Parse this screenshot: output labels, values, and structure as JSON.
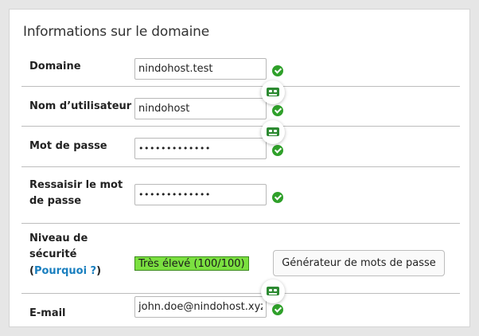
{
  "section": {
    "title": "Informations sur le domaine"
  },
  "rows": {
    "domain": {
      "label": "Domaine",
      "value": "nindohost.test"
    },
    "username": {
      "label": "Nom d’utilisateur",
      "value": "nindohost"
    },
    "password": {
      "label": "Mot de passe",
      "value": "•••••••••••••"
    },
    "confirm": {
      "label_line1": "Ressaisir le mot",
      "label_line2": "de passe",
      "value": "•••••••••••••"
    },
    "security": {
      "label_line1": "Niveau de",
      "label_line2": "sécurité",
      "paren_open": "(",
      "why_link": "Pourquoi ?",
      "paren_close": ")",
      "strength_text": "Très élevé (100/100)",
      "strength_percent": 100,
      "generator_button": "Générateur de mots de passe"
    },
    "email": {
      "label": "E-mail",
      "value": "john.doe@nindohost.xyz"
    }
  },
  "icons": {
    "check": "check-circle-icon",
    "keyboard": "keyboard-icon"
  },
  "colors": {
    "check": "#2fa02a",
    "strength_bg": "#7be040",
    "link": "#1a7fbf",
    "kb_icon": "#2c8a31"
  }
}
